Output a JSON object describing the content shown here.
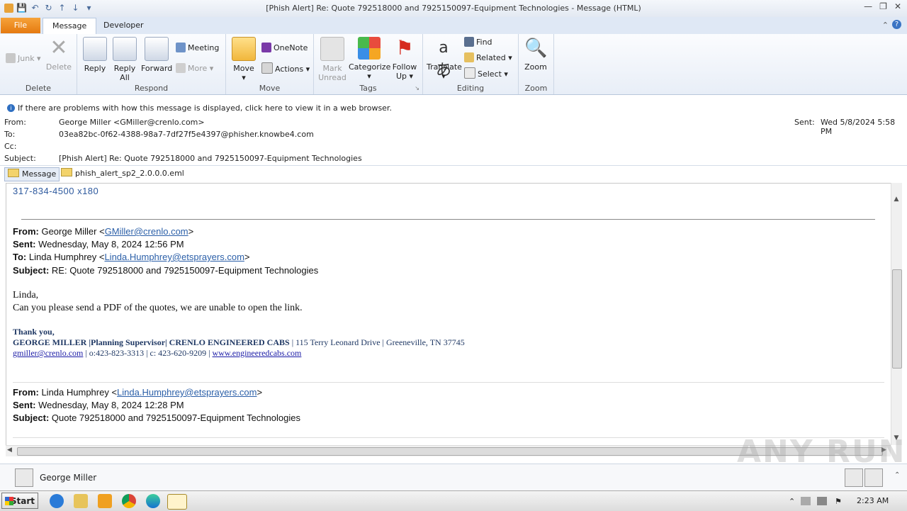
{
  "window": {
    "title": "[Phish Alert] Re: Quote 792518000 and 7925150097-Equipment Technologies - Message (HTML)"
  },
  "tabs": {
    "file": "File",
    "message": "Message",
    "developer": "Developer"
  },
  "ribbon": {
    "delete_group": {
      "label": "Delete",
      "junk": "Junk",
      "delete": "Delete"
    },
    "respond_group": {
      "label": "Respond",
      "reply": "Reply",
      "reply_all_1": "Reply",
      "reply_all_2": "All",
      "forward": "Forward",
      "meeting": "Meeting",
      "more": "More"
    },
    "move_group": {
      "label": "Move",
      "move": "Move",
      "onenote": "OneNote",
      "actions": "Actions"
    },
    "tags_group": {
      "label": "Tags",
      "mark_unread_1": "Mark",
      "mark_unread_2": "Unread",
      "categorize": "Categorize",
      "follow_up_1": "Follow",
      "follow_up_2": "Up"
    },
    "editing_group": {
      "label": "Editing",
      "translate": "Translate",
      "find": "Find",
      "related": "Related",
      "select": "Select"
    },
    "zoom_group": {
      "label": "Zoom",
      "zoom": "Zoom"
    }
  },
  "info_bar": "If there are problems with how this message is displayed, click here to view it in a web browser.",
  "header": {
    "from_label": "From:",
    "from": "George Miller <GMiller@crenlo.com>",
    "to_label": "To:",
    "to": "03ea82bc-0f62-4388-98a7-7df27f5e4397@phisher.knowbe4.com",
    "cc_label": "Cc:",
    "subject_label": "Subject:",
    "subject": "[Phish Alert] Re: Quote 792518000 and 7925150097-Equipment Technologies",
    "sent_label": "Sent:",
    "sent": "Wed 5/8/2024 5:58 PM"
  },
  "attachments": {
    "message": "Message",
    "eml": "phish_alert_sp2_2.0.0.0.eml"
  },
  "body": {
    "phone": "317-834-4500 x180",
    "m1": {
      "from_label": "From:",
      "from_name": " George Miller <",
      "from_email": "GMiller@crenlo.com",
      "from_close": ">",
      "sent_label": "Sent:",
      "sent": " Wednesday, May 8, 2024 12:56 PM",
      "to_label": "To:",
      "to_name": " Linda Humphrey <",
      "to_email": "Linda.Humphrey@etsprayers.com",
      "to_close": ">",
      "subject_label": "Subject:",
      "subject": " RE: Quote 792518000 and 7925150097-Equipment Technologies",
      "greeting": "Linda,",
      "text": "Can you please send a PDF of the quotes, we are unable to open the link.",
      "thanks": "Thank you,",
      "sig_bold": "GEORGE MILLER |Planning Supervisor| CRENLO ENGINEERED CABS",
      "sig_addr": " | 115 Terry Leonard Drive | Greeneville, TN 37745",
      "sig_email": "gmiller@crenlo.com",
      "sig_phones": " | o:423-823-3313 | c: 423-620-9209 | ",
      "sig_web": "www.engineeredcabs.com"
    },
    "m2": {
      "from_label": "From:",
      "from_name": " Linda Humphrey <",
      "from_email": "Linda.Humphrey@etsprayers.com",
      "from_close": ">",
      "sent_label": "Sent:",
      "sent": " Wednesday, May 8, 2024 12:28 PM",
      "subject_label": "Subject:",
      "subject": " Quote 792518000 and 7925150097-Equipment Technologies"
    }
  },
  "people_pane": {
    "name": "George Miller"
  },
  "taskbar": {
    "start": "Start",
    "clock": "2:23 AM"
  },
  "watermark": "ANY RUN"
}
